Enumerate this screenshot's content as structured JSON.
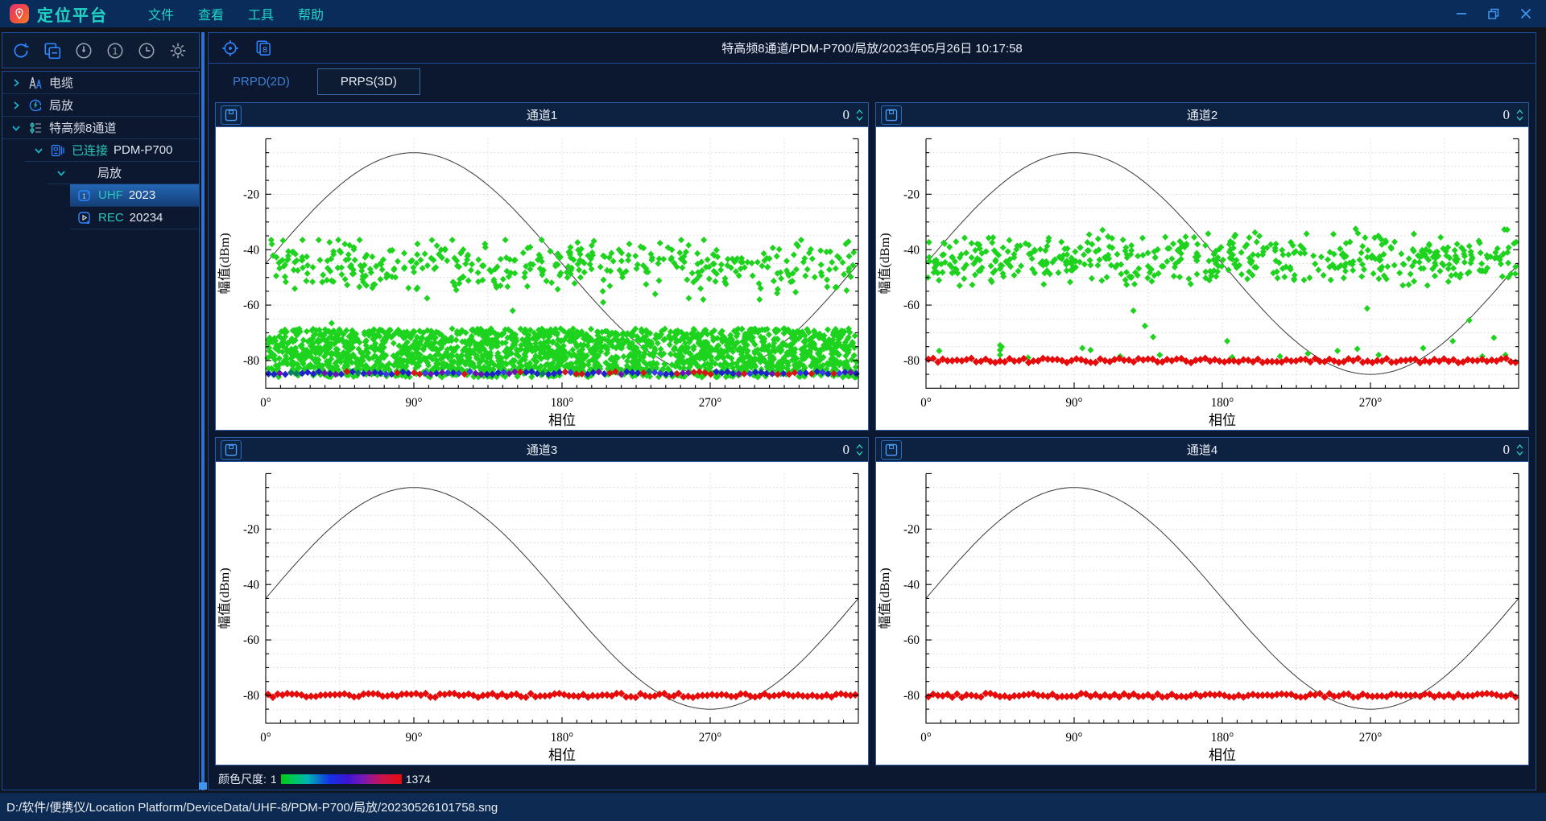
{
  "window": {
    "title": "定位平台",
    "menus": [
      "文件",
      "查看",
      "工具",
      "帮助"
    ]
  },
  "sidebar": {
    "toolbar_icons": [
      "refresh",
      "window-copy",
      "gauge",
      "one-circle",
      "clock",
      "gear"
    ],
    "tree": [
      {
        "label": "电缆",
        "state": "collapsed"
      },
      {
        "label": "局放",
        "state": "collapsed"
      },
      {
        "label": "特高频8通道",
        "state": "expanded"
      },
      {
        "status": "已连接",
        "label": "PDM-P700",
        "state": "expanded"
      },
      {
        "label": "局放",
        "state": "expanded"
      },
      {
        "prefix": "UHF",
        "label": "2023",
        "selected": true
      },
      {
        "prefix": "REC",
        "label": "20234",
        "selected": false
      }
    ]
  },
  "main": {
    "toolbar_icons": [
      "target",
      "layers-8"
    ],
    "header": {
      "title": "特高频8通道/PDM-P700/局放/2023年05月26日 10:17:58"
    },
    "tabs": [
      {
        "label": "PRPD(2D)",
        "active": false
      },
      {
        "label": "PRPS(3D)",
        "active": true
      }
    ],
    "panels": [
      {
        "counter": "0"
      },
      {
        "counter": "0"
      },
      {
        "counter": "0"
      },
      {
        "counter": "0"
      }
    ],
    "colorbar": {
      "label": "颜色尺度:",
      "min": "1",
      "max": "1374"
    }
  },
  "statusbar": {
    "path": "D:/软件/便携仪/Location Platform/DeviceData/UHF-8/PDM-P700/局放/20230526101758.sng"
  },
  "chart_data": [
    {
      "type": "scatter",
      "title": "通道1",
      "xlabel": "相位",
      "ylabel": "幅值(dBm)",
      "xlim": [
        0,
        360
      ],
      "ylim": [
        -90,
        0
      ],
      "xticks": [
        0,
        90,
        180,
        270
      ],
      "xtick_suffix": "°",
      "yticks": [
        -20,
        -40,
        -60,
        -80
      ],
      "grid": "dotted",
      "sine": {
        "center": -45,
        "amplitude": 40
      },
      "seed": 11,
      "clusters": [
        {
          "color": "#1ed31e",
          "size": 4,
          "count": 420,
          "x": [
            2,
            358
          ],
          "y": {
            "type": "normal",
            "mean": -45.5,
            "sd": 4.6,
            "min": -58,
            "max": -36.5
          }
        },
        {
          "color": "#1ed31e",
          "size": 4,
          "count": 2100,
          "x": [
            1,
            359
          ],
          "y": {
            "type": "uniform",
            "min": -86,
            "max": -68.5
          }
        }
      ],
      "outliers": [
        {
          "color": "#1ed31e",
          "size": 4,
          "points": [
            [
              40,
              -66.5
            ],
            [
              98,
              -57.5
            ],
            [
              150,
              -62
            ],
            [
              205,
              -59
            ],
            [
              257,
              -57.5
            ],
            [
              300,
              -58
            ]
          ]
        }
      ],
      "baseline": {
        "y": -84.5,
        "step": 3.4,
        "size": 4.3,
        "jitter": 0.5,
        "colors": [
          {
            "c": "#2020cc",
            "w": 0.4
          },
          {
            "c": "#3a3ae8",
            "w": 0.12
          },
          {
            "c": "#6a14b4",
            "w": 0.18
          },
          {
            "c": "#d81414",
            "w": 0.2
          },
          {
            "c": "#0e7a6a",
            "w": 0.1
          }
        ]
      }
    },
    {
      "type": "scatter",
      "title": "通道2",
      "xlabel": "相位",
      "ylabel": "幅值(dBm)",
      "xlim": [
        0,
        360
      ],
      "ylim": [
        -90,
        0
      ],
      "xticks": [
        0,
        90,
        180,
        270
      ],
      "xtick_suffix": "°",
      "yticks": [
        -20,
        -40,
        -60,
        -80
      ],
      "grid": "dotted",
      "sine": {
        "center": -45,
        "amplitude": 40
      },
      "seed": 22,
      "clusters": [
        {
          "color": "#1ed31e",
          "size": 4,
          "count": 520,
          "x": [
            1,
            359
          ],
          "y": {
            "type": "normal",
            "mean": -43.5,
            "sd": 4.2,
            "min": -55.5,
            "max": -31.5
          }
        }
      ],
      "outliers": [
        {
          "color": "#1ed31e",
          "size": 4,
          "points": [
            [
              8,
              -76.5
            ],
            [
              45,
              -74.5
            ],
            [
              45,
              -76.2
            ],
            [
              45,
              -78
            ],
            [
              46,
              -75
            ],
            [
              62,
              -79
            ],
            [
              95,
              -75.5
            ],
            [
              100,
              -76.2
            ],
            [
              118,
              -78.5
            ],
            [
              126,
              -62
            ],
            [
              133,
              -67.5
            ],
            [
              138,
              -71.5
            ],
            [
              142,
              -78
            ],
            [
              183,
              -73
            ],
            [
              186,
              -78.8
            ],
            [
              215,
              -78.5
            ],
            [
              232,
              -77.5
            ],
            [
              250,
              -76.5
            ],
            [
              262,
              -75.8
            ],
            [
              268,
              -61.2
            ],
            [
              275,
              -78
            ],
            [
              302,
              -75.5
            ],
            [
              320,
              -73
            ],
            [
              330,
              -65.5
            ],
            [
              338,
              -78.5
            ],
            [
              345,
              -71.8
            ],
            [
              352,
              -78
            ]
          ]
        }
      ],
      "baseline": {
        "y": -80,
        "step": 2.9,
        "size": 4.6,
        "jitter": 0.8,
        "colors": [
          {
            "c": "#e60c0c",
            "w": 1
          }
        ]
      }
    },
    {
      "type": "scatter",
      "title": "通道3",
      "xlabel": "相位",
      "ylabel": "幅值(dBm)",
      "xlim": [
        0,
        360
      ],
      "ylim": [
        -90,
        0
      ],
      "xticks": [
        0,
        90,
        180,
        270
      ],
      "xtick_suffix": "°",
      "yticks": [
        -20,
        -40,
        -60,
        -80
      ],
      "grid": "dotted",
      "sine": {
        "center": -45,
        "amplitude": 40
      },
      "seed": 33,
      "clusters": [],
      "outliers": [],
      "baseline": {
        "y": -80,
        "step": 2.9,
        "size": 4.6,
        "jitter": 0.7,
        "colors": [
          {
            "c": "#e60c0c",
            "w": 1
          }
        ]
      }
    },
    {
      "type": "scatter",
      "title": "通道4",
      "xlabel": "相位",
      "ylabel": "幅值(dBm)",
      "xlim": [
        0,
        360
      ],
      "ylim": [
        -90,
        0
      ],
      "xticks": [
        0,
        90,
        180,
        270
      ],
      "xtick_suffix": "°",
      "yticks": [
        -20,
        -40,
        -60,
        -80
      ],
      "grid": "dotted",
      "sine": {
        "center": -45,
        "amplitude": 40
      },
      "seed": 44,
      "clusters": [],
      "outliers": [],
      "baseline": {
        "y": -80,
        "step": 2.9,
        "size": 4.6,
        "jitter": 0.7,
        "colors": [
          {
            "c": "#e60c0c",
            "w": 1
          }
        ]
      }
    }
  ]
}
